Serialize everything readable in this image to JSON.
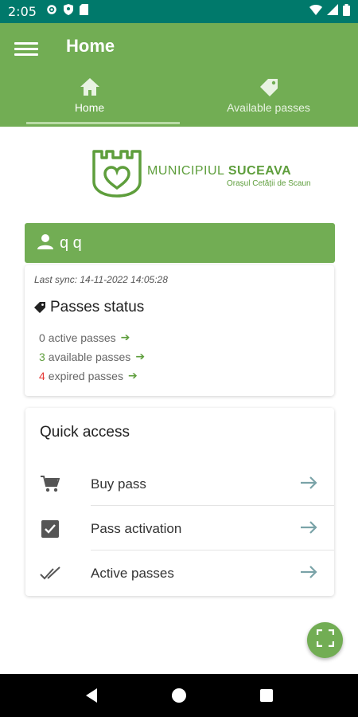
{
  "status_bar": {
    "time": "2:05"
  },
  "app_bar": {
    "title": "Home"
  },
  "tabs": [
    {
      "label": "Home",
      "icon": "home-icon",
      "active": true
    },
    {
      "label": "Available passes",
      "icon": "tag-icon",
      "active": false
    }
  ],
  "logo": {
    "name_prefix": "MUNICIPIUL",
    "name_city": "SUCEAVA",
    "tagline": "Orașul Cetății de Scaun"
  },
  "user": {
    "name": "q q"
  },
  "status_card": {
    "last_sync": "Last sync: 14-11-2022 14:05:28",
    "title": "Passes status",
    "lines": [
      {
        "count": "0",
        "text": "active passes",
        "color": "#666666"
      },
      {
        "count": "3",
        "text": "available passes",
        "color": "#5e9e3c"
      },
      {
        "count": "4",
        "text": "expired passes",
        "color": "#e53935"
      }
    ]
  },
  "quick_access": {
    "title": "Quick access",
    "items": [
      {
        "label": "Buy pass",
        "icon": "cart-icon"
      },
      {
        "label": "Pass activation",
        "icon": "checkbox-icon"
      },
      {
        "label": "Active passes",
        "icon": "double-check-icon"
      }
    ]
  },
  "colors": {
    "primary": "#72ad54",
    "status_bar": "#00796b",
    "accent_arrow": "#7aa3a8"
  }
}
